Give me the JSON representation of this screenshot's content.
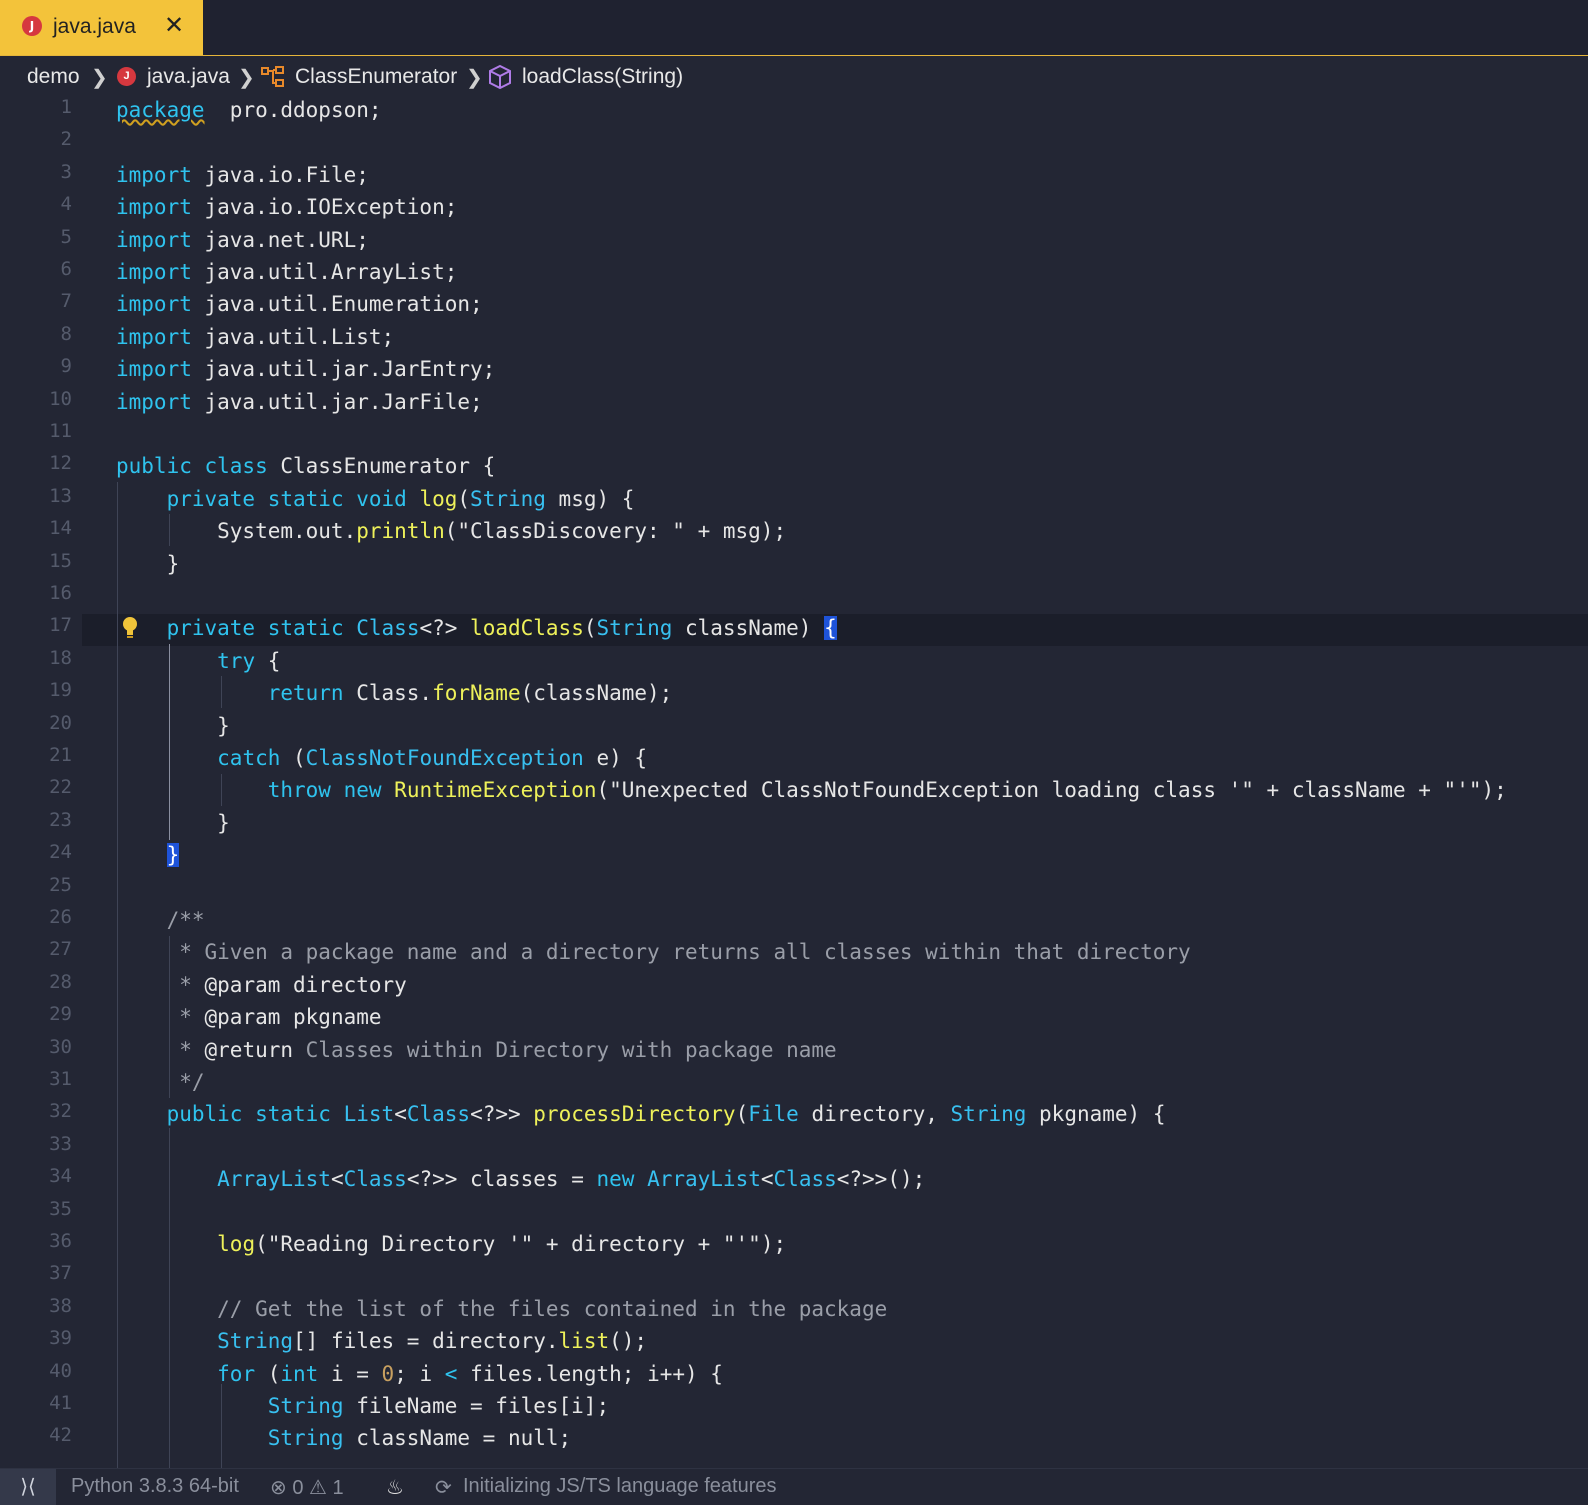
{
  "tab": {
    "label": "java.java",
    "icon_letter": "J",
    "close": "✕"
  },
  "breadcrumb": {
    "items": [
      "demo",
      "java.java",
      "ClassEnumerator",
      "loadClass(String)"
    ],
    "sep": "❯"
  },
  "editor": {
    "line_numbers": [
      "1",
      "2",
      "3",
      "4",
      "5",
      "6",
      "7",
      "8",
      "9",
      "10",
      "11",
      "12",
      "13",
      "14",
      "15",
      "16",
      "17",
      "18",
      "19",
      "20",
      "21",
      "22",
      "23",
      "24",
      "25",
      "26",
      "27",
      "28",
      "29",
      "30",
      "31",
      "32",
      "33",
      "34",
      "35",
      "36",
      "37",
      "38",
      "39",
      "40",
      "41",
      "42"
    ],
    "lines": [
      [
        [
          "kw sq",
          "package"
        ],
        [
          "",
          "  pro.ddopson;"
        ]
      ],
      [],
      [
        [
          "kw",
          "import"
        ],
        [
          "",
          " java.io.File;"
        ]
      ],
      [
        [
          "kw",
          "import"
        ],
        [
          "",
          " java.io.IOException;"
        ]
      ],
      [
        [
          "kw",
          "import"
        ],
        [
          "",
          " java.net.URL;"
        ]
      ],
      [
        [
          "kw",
          "import"
        ],
        [
          "",
          " java.util.ArrayList;"
        ]
      ],
      [
        [
          "kw",
          "import"
        ],
        [
          "",
          " java.util.Enumeration;"
        ]
      ],
      [
        [
          "kw",
          "import"
        ],
        [
          "",
          " java.util.List;"
        ]
      ],
      [
        [
          "kw",
          "import"
        ],
        [
          "",
          " java.util.jar.JarEntry;"
        ]
      ],
      [
        [
          "kw",
          "import"
        ],
        [
          "",
          " java.util.jar.JarFile;"
        ]
      ],
      [],
      [
        [
          "kw",
          "public class"
        ],
        [
          "",
          " ClassEnumerator {"
        ]
      ],
      [
        [
          "",
          "    "
        ],
        [
          "kw",
          "private static void"
        ],
        [
          "",
          " "
        ],
        [
          "fn",
          "log"
        ],
        [
          "",
          "("
        ],
        [
          "ty",
          "String"
        ],
        [
          "",
          " msg) {"
        ]
      ],
      [
        [
          "",
          "        System.out."
        ],
        [
          "fn",
          "println"
        ],
        [
          "",
          "(\"ClassDiscovery: \" + msg);"
        ]
      ],
      [
        [
          "",
          "    }"
        ]
      ],
      [],
      [
        [
          "",
          "    "
        ],
        [
          "kw",
          "private static"
        ],
        [
          "",
          " "
        ],
        [
          "ty",
          "Class"
        ],
        [
          "",
          "<?> "
        ],
        [
          "fn",
          "loadClass"
        ],
        [
          "",
          "("
        ],
        [
          "ty",
          "String"
        ],
        [
          "",
          " className) "
        ],
        [
          "bracket-hl",
          "{"
        ]
      ],
      [
        [
          "",
          "        "
        ],
        [
          "kw",
          "try"
        ],
        [
          "",
          " {"
        ]
      ],
      [
        [
          "",
          "            "
        ],
        [
          "kw",
          "return"
        ],
        [
          "",
          " Class."
        ],
        [
          "fn",
          "forName"
        ],
        [
          "",
          "(className);"
        ]
      ],
      [
        [
          "",
          "        }"
        ]
      ],
      [
        [
          "",
          "        "
        ],
        [
          "kw",
          "catch"
        ],
        [
          "",
          " ("
        ],
        [
          "ty",
          "ClassNotFoundException"
        ],
        [
          "",
          " e) {"
        ]
      ],
      [
        [
          "",
          "            "
        ],
        [
          "kw",
          "throw new"
        ],
        [
          "",
          " "
        ],
        [
          "fn",
          "RuntimeException"
        ],
        [
          "",
          "(\"Unexpected ClassNotFoundException loading class '\" + className + \"'\");"
        ]
      ],
      [
        [
          "",
          "        }"
        ]
      ],
      [
        [
          "",
          "    "
        ],
        [
          "bracket-hl",
          "}"
        ]
      ],
      [],
      [
        [
          "cm",
          "    /**"
        ]
      ],
      [
        [
          "cm",
          "     * Given a package name and a directory returns all classes within that directory"
        ]
      ],
      [
        [
          "cm",
          "     * "
        ],
        [
          "",
          "@param directory"
        ]
      ],
      [
        [
          "cm",
          "     * "
        ],
        [
          "",
          "@param pkgname"
        ]
      ],
      [
        [
          "cm",
          "     * "
        ],
        [
          "",
          "@return"
        ],
        [
          "cm",
          " Classes within Directory with package name"
        ]
      ],
      [
        [
          "cm",
          "     */"
        ]
      ],
      [
        [
          "",
          "    "
        ],
        [
          "kw",
          "public static"
        ],
        [
          "",
          " "
        ],
        [
          "ty",
          "List"
        ],
        [
          "",
          "<"
        ],
        [
          "ty",
          "Class"
        ],
        [
          "",
          "<?>> "
        ],
        [
          "fn",
          "processDirectory"
        ],
        [
          "",
          "("
        ],
        [
          "ty",
          "File"
        ],
        [
          "",
          " directory, "
        ],
        [
          "ty",
          "String"
        ],
        [
          "",
          " pkgname) {"
        ]
      ],
      [],
      [
        [
          "",
          "        "
        ],
        [
          "ty",
          "ArrayList"
        ],
        [
          "",
          "<"
        ],
        [
          "ty",
          "Class"
        ],
        [
          "",
          "<?>> classes = "
        ],
        [
          "kw",
          "new"
        ],
        [
          "",
          " "
        ],
        [
          "ty",
          "ArrayList"
        ],
        [
          "",
          "<"
        ],
        [
          "ty",
          "Class"
        ],
        [
          "",
          "<?>>();"
        ]
      ],
      [],
      [
        [
          "",
          "        "
        ],
        [
          "fn",
          "log"
        ],
        [
          "",
          "(\"Reading Directory '\" + directory + \"'\");"
        ]
      ],
      [],
      [
        [
          "cm",
          "        // Get the list of the files contained in the package"
        ]
      ],
      [
        [
          "",
          "        "
        ],
        [
          "ty",
          "String"
        ],
        [
          "",
          "[] files = directory."
        ],
        [
          "fn",
          "list"
        ],
        [
          "",
          "();"
        ]
      ],
      [
        [
          "",
          "        "
        ],
        [
          "kw",
          "for"
        ],
        [
          "",
          " ("
        ],
        [
          "kw",
          "int"
        ],
        [
          "",
          " i = "
        ],
        [
          "num",
          "0"
        ],
        [
          "",
          "; i "
        ],
        [
          "kw",
          "<"
        ],
        [
          "",
          " files.length; i++) {"
        ]
      ],
      [
        [
          "",
          "            "
        ],
        [
          "ty",
          "String"
        ],
        [
          "",
          " fileName = files[i];"
        ]
      ],
      [
        [
          "",
          "            "
        ],
        [
          "ty",
          "String"
        ],
        [
          "",
          " className = null;"
        ]
      ]
    ]
  },
  "status": {
    "remote_icon": "⟩⟨",
    "python": "Python 3.8.3 64-bit",
    "errors": "0",
    "warnings": "1",
    "error_icon": "⊗",
    "warning_icon": "⚠",
    "flame_icon": "♨",
    "sync_icon": "⟳",
    "message": "Initializing JS/TS language features"
  }
}
